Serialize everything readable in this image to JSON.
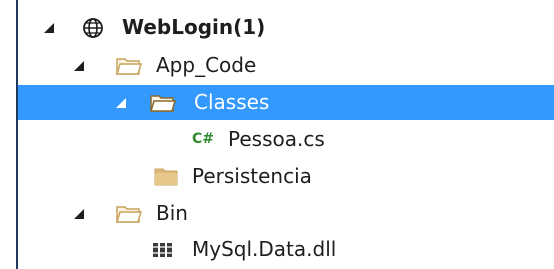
{
  "tree": {
    "project": {
      "label": "WebLogin(1)",
      "icon": "globe-icon",
      "expanded": true
    },
    "app_code": {
      "label": "App_Code",
      "icon": "folder-open-icon",
      "expanded": true
    },
    "classes": {
      "label": "Classes",
      "icon": "folder-open-icon",
      "expanded": true,
      "selected": true
    },
    "pessoa": {
      "label": "Pessoa.cs",
      "icon": "csharp-file-icon",
      "badge": "C#"
    },
    "persistencia": {
      "label": "Persistencia",
      "icon": "folder-closed-icon"
    },
    "bin": {
      "label": "Bin",
      "icon": "folder-open-icon",
      "expanded": true
    },
    "mysql": {
      "label": "MySql.Data.dll",
      "icon": "assembly-icon"
    }
  },
  "colors": {
    "selection": "#3399ff",
    "folder": "#dcb67a",
    "csharp": "#2c8a2c"
  }
}
